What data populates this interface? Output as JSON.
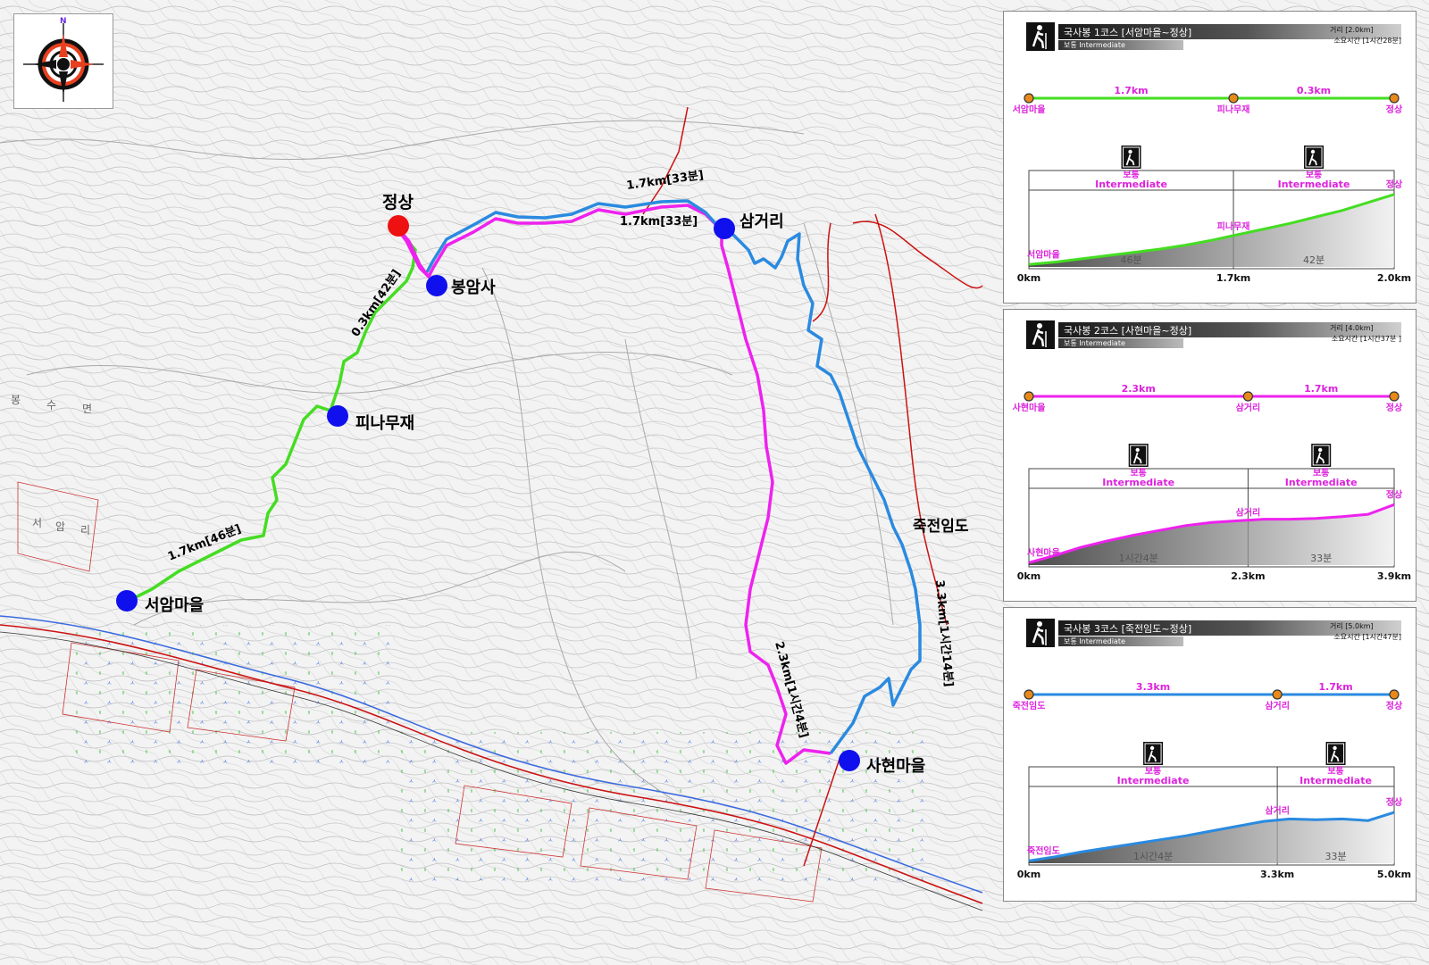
{
  "map": {
    "compass_north": "N",
    "summit": "정상",
    "places": {
      "bongamsa": "봉암사",
      "samgeori": "삼거리",
      "pinamujae": "피나무재",
      "seoam": "서암마을",
      "sahyeon": "사현마을",
      "jukjeon": "죽전임도"
    },
    "route_labels": {
      "seoam_pinamu": "1.7km[46분]",
      "pinamu_summit": "0.3km[42분]",
      "bongam_samgeori_top": "1.7km[33분]",
      "bongam_samgeori_bottom": "1.7km[33분]",
      "sahyeon_samgeori": "2.3km[1시간4분]",
      "jukjeon_samgeori": "3.3km[1시간14분]"
    },
    "town_text": [
      "봉",
      "수",
      "면",
      "서",
      "암",
      "리"
    ],
    "colors": {
      "course1": "#44dd22",
      "course2": "#ee22ee",
      "course3": "#2a8ae0",
      "road": "#cc1111",
      "marker": "#1010ee",
      "summit_marker": "#ee1111"
    }
  },
  "panels": [
    {
      "title": "국사봉 1코스 [서암마을~정상]",
      "level": "보통 Intermediate",
      "distance": "거리 [2.0km]",
      "time": "소요시간 [1시간28분]",
      "color": "#44dd22",
      "start": "서암마을",
      "mid": "피나무재",
      "end": "정상",
      "seg1": "1.7km",
      "seg2": "0.3km",
      "grade_kr": "보통",
      "grade_en": "Intermediate",
      "time1": "46분",
      "time2": "42분",
      "x0": "0km",
      "x1": "1.7km",
      "x2": "2.0km",
      "split": 0.56,
      "profile": [
        0.03,
        0.06,
        0.1,
        0.14,
        0.18,
        0.22,
        0.27,
        0.33,
        0.4,
        0.47,
        0.54,
        0.62,
        0.7,
        0.8,
        0.9
      ]
    },
    {
      "title": "국사봉 2코스 [사현마을~정상]",
      "level": "보통 Intermediate",
      "distance": "거리 [4.0km]",
      "time": "소요시간 [1시간37분 ]",
      "color": "#ee22ee",
      "start": "사현마을",
      "mid": "삼거리",
      "end": "정상",
      "seg1": "2.3km",
      "seg2": "1.7km",
      "grade_kr": "보통",
      "grade_en": "Intermediate",
      "time1": "1시간4분",
      "time2": "33분",
      "x0": "0km",
      "x1": "2.3km",
      "x2": "3.9km",
      "split": 0.6,
      "profile": [
        0.03,
        0.12,
        0.22,
        0.3,
        0.37,
        0.43,
        0.49,
        0.53,
        0.55,
        0.57,
        0.57,
        0.58,
        0.6,
        0.63,
        0.75
      ]
    },
    {
      "title": "국사봉 3코스 [죽전임도~정상]",
      "level": "보통 Intermediate",
      "distance": "거리 [5.0km]",
      "time": "소요시간 [1시간47분]",
      "color": "#2a8ae0",
      "start": "죽전임도",
      "mid": "삼거리",
      "end": "정상",
      "seg1": "3.3km",
      "seg2": "1.7km",
      "grade_kr": "보통",
      "grade_en": "Intermediate",
      "time1": "1시간4분",
      "time2": "33분",
      "x0": "0km",
      "x1": "3.3km",
      "x2": "5.0km",
      "split": 0.68,
      "profile": [
        0.03,
        0.08,
        0.14,
        0.19,
        0.24,
        0.29,
        0.34,
        0.4,
        0.46,
        0.52,
        0.55,
        0.54,
        0.55,
        0.53,
        0.63
      ]
    }
  ]
}
